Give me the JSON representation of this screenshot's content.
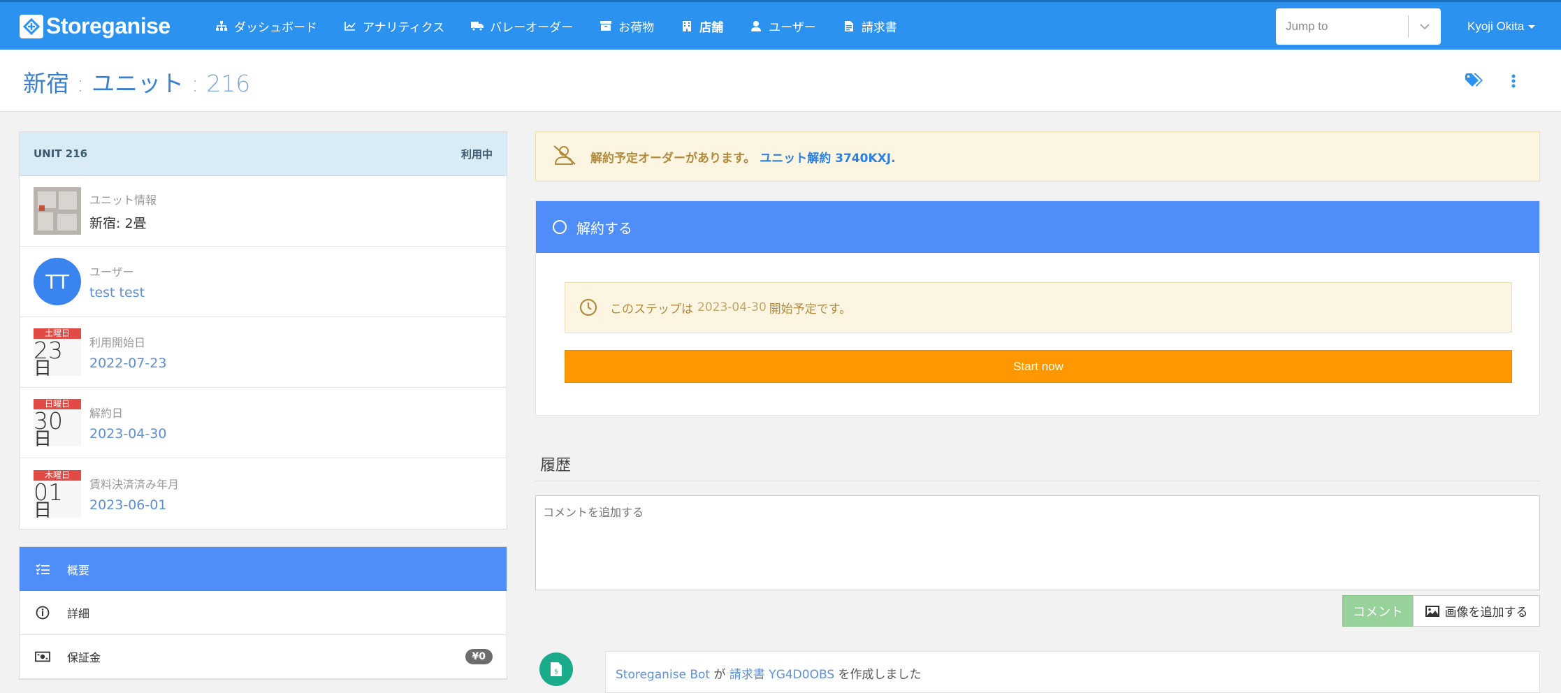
{
  "navbar": {
    "brand": "Storeganise",
    "items": [
      {
        "label": "ダッシュボード",
        "icon": "sitemap-icon"
      },
      {
        "label": "アナリティクス",
        "icon": "chart-icon"
      },
      {
        "label": "バレーオーダー",
        "icon": "truck-icon"
      },
      {
        "label": "お荷物",
        "icon": "archive-icon"
      },
      {
        "label": "店舗",
        "icon": "building-icon"
      },
      {
        "label": "ユーザー",
        "icon": "user-icon"
      },
      {
        "label": "請求書",
        "icon": "invoice-icon"
      }
    ],
    "jump_placeholder": "Jump to",
    "user_name": "Kyoji Okita",
    "color": "#2b93ef"
  },
  "header": {
    "site": "新宿",
    "sep": ":",
    "unit_label": "ユニット",
    "unit_number": "216"
  },
  "unit_panel": {
    "title": "UNIT 216",
    "status": "利用中",
    "unit_info_label": "ユニット情報",
    "unit_info_value": "新宿: 2畳",
    "user_avatar": "TT",
    "user_label": "ユーザー",
    "user_value": "test test",
    "start": {
      "weekday": "土曜日",
      "day": "23",
      "suffix": "日",
      "label": "利用開始日",
      "value": "2022-07-23"
    },
    "end": {
      "weekday": "日曜日",
      "day": "30",
      "suffix": "日",
      "label": "解約日",
      "value": "2023-04-30"
    },
    "paid": {
      "weekday": "木曜日",
      "day": "01",
      "suffix": "日",
      "label": "賃料決済済み年月",
      "value": "2023-06-01"
    }
  },
  "side_menu": [
    {
      "label": "概要",
      "icon": "list-check-icon",
      "active": true
    },
    {
      "label": "詳細",
      "icon": "info-circle-icon"
    },
    {
      "label": "保証金",
      "icon": "money-icon",
      "badge": "¥0"
    }
  ],
  "alert": {
    "text": "解約予定オーダーがあります。",
    "link": "ユニット解約 3740KXJ."
  },
  "step": {
    "title": "解約する",
    "note_pre": "このステップは",
    "note_date": "2023-04-30",
    "note_post": "開始予定です。",
    "button": "Start now"
  },
  "history": {
    "title": "履歴",
    "comment_placeholder": "コメントを追加する",
    "comment_button": "コメント",
    "image_button": "画像を追加する",
    "entry": {
      "actor": "Storeganise Bot",
      "particle": "が",
      "link": "請求書 YG4D0OBS",
      "suffix": "を作成しました"
    }
  }
}
